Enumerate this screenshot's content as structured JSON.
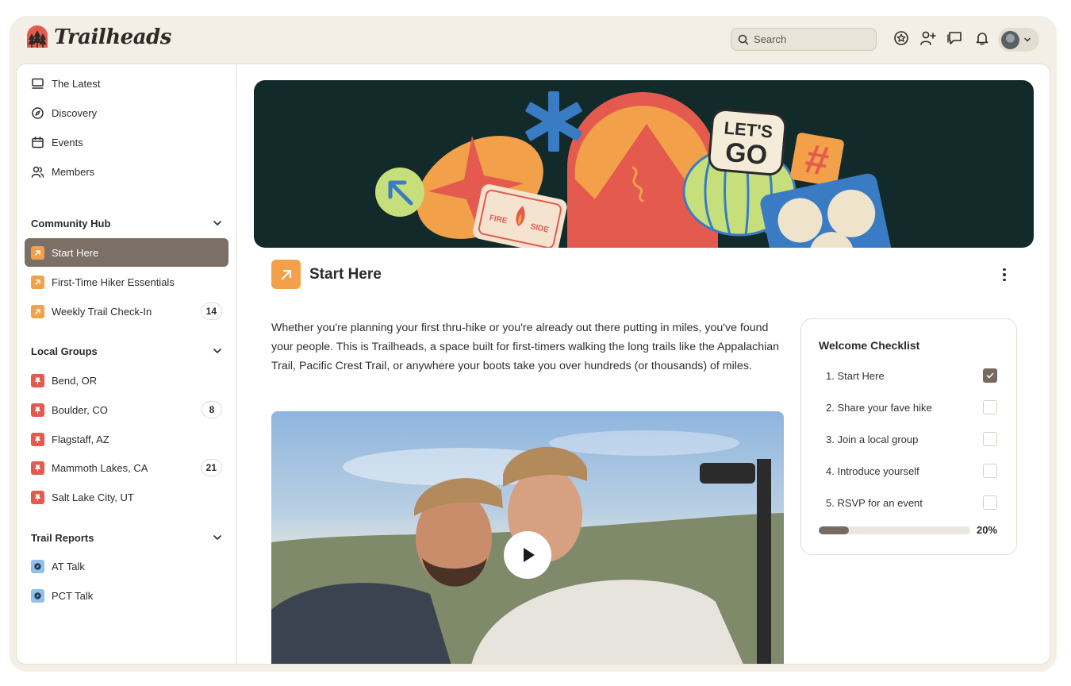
{
  "app": {
    "logo_text": "Trailheads"
  },
  "header": {
    "search_placeholder": "Search",
    "icons": [
      "badge-star-icon",
      "add-person-icon",
      "chat-icon",
      "bell-icon",
      "avatar",
      "chevron-down-icon"
    ]
  },
  "sidebar": {
    "primary": [
      {
        "label": "The Latest",
        "icon": "monitor-icon"
      },
      {
        "label": "Discovery",
        "icon": "compass-icon"
      },
      {
        "label": "Events",
        "icon": "calendar-icon"
      },
      {
        "label": "Members",
        "icon": "people-icon"
      }
    ],
    "sections": [
      {
        "title": "Community Hub",
        "items": [
          {
            "label": "Start Here",
            "icon": "arrow-up-right-icon",
            "count": "",
            "active": true
          },
          {
            "label": "First-Time Hiker Essentials",
            "icon": "arrow-up-right-icon",
            "count": ""
          },
          {
            "label": "Weekly Trail Check-In",
            "icon": "arrow-up-right-icon",
            "count": "14"
          }
        ]
      },
      {
        "title": "Local Groups",
        "items": [
          {
            "label": "Bend, OR",
            "icon": "pin-icon",
            "count": ""
          },
          {
            "label": "Boulder, CO",
            "icon": "pin-icon",
            "count": "8"
          },
          {
            "label": "Flagstaff, AZ",
            "icon": "pin-icon",
            "count": ""
          },
          {
            "label": "Mammoth Lakes, CA",
            "icon": "pin-icon",
            "count": "21"
          },
          {
            "label": "Salt Lake City, UT",
            "icon": "pin-icon",
            "count": ""
          }
        ]
      },
      {
        "title": "Trail Reports",
        "items": [
          {
            "label": "AT Talk",
            "icon": "compass-icon"
          },
          {
            "label": "PCT Talk",
            "icon": "compass-icon"
          }
        ]
      }
    ]
  },
  "main": {
    "banner": {
      "sticker_texts": [
        "LET'S",
        "GO",
        "FIRE",
        "SIDE"
      ]
    },
    "title": "Start Here",
    "intro": "Whether you're planning your first thru-hike or you're already out there putting in miles, you've found your people. This is Trailheads, a space built for first-timers walking the long trails like the Appalachian Trail, Pacific Crest Trail, or anywhere your boots take you over hundreds (or thousands) of miles."
  },
  "checklist": {
    "title": "Welcome Checklist",
    "items": [
      {
        "label": "1. Start Here",
        "checked": true
      },
      {
        "label": "2. Share your fave hike",
        "checked": false
      },
      {
        "label": "3. Join a local group",
        "checked": false
      },
      {
        "label": "4. Introduce yourself",
        "checked": false
      },
      {
        "label": "5. RSVP for an event",
        "checked": false
      }
    ],
    "progress": 0.2,
    "progress_label": "20%"
  },
  "colors": {
    "accent": "#7b6f66",
    "orange": "#f2a04a",
    "red": "#e45a4f",
    "blue": "#8ec1ec",
    "banner_bg": "#132a2b"
  }
}
